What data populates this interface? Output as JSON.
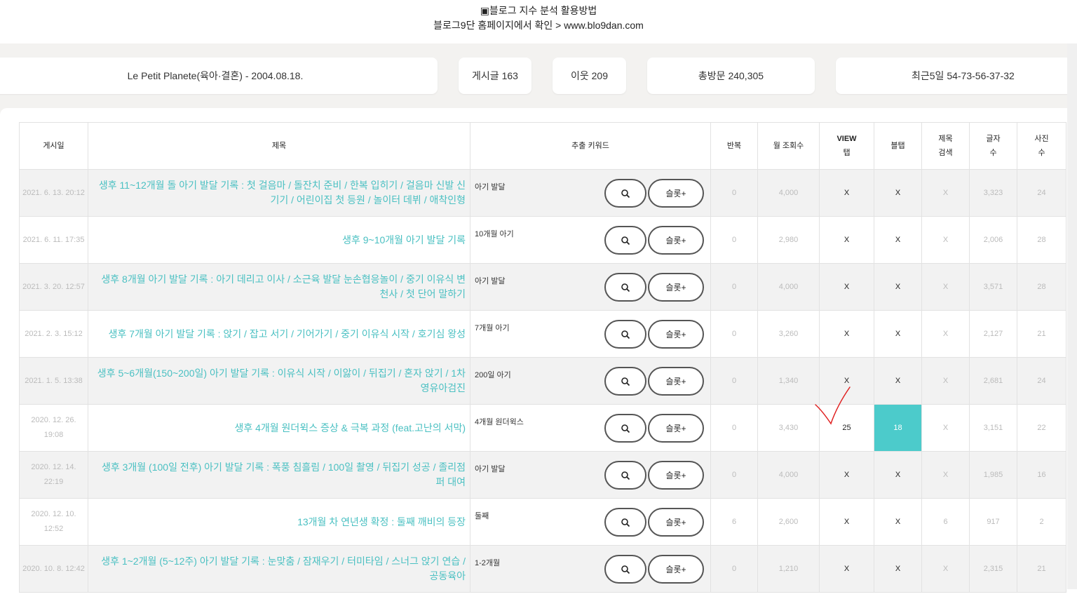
{
  "header": {
    "line1": "▣블로그 지수 분석 활용방법",
    "line2": "블로그9단 홈페이지에서 확인 > www.blo9dan.com"
  },
  "stats": {
    "blog": "Le Petit Planete(육아·결혼) - 2004.08.18.",
    "posts": "게시글 163",
    "neighbors": "이웃 209",
    "total_visits": "총방문 240,305",
    "recent": "최근5일 54-73-56-37-32"
  },
  "table": {
    "headers": {
      "date": "게시일",
      "title": "제목",
      "keyword": "추출 키워드",
      "repeat": "반복",
      "monthly": "월 조회수",
      "view1": "VIEW",
      "view2": "탭",
      "blog_tab": "블탭",
      "tsearch1": "제목",
      "tsearch2": "검색",
      "chars1": "글자",
      "chars2": "수",
      "photos1": "사진",
      "photos2": "수"
    },
    "slot_label": "슬롯+",
    "rows": [
      {
        "date": "2021. 6. 13. 20:12",
        "title": "생후 11~12개월 돌 아기 발달 기록 : 첫 걸음마 / 돌잔치 준비 / 한복 입히기 / 걸음마 신발 신기기 / 어린이집 첫 등원 / 놀이터 데뷔 / 애착인형",
        "keyword": "아기 발달",
        "repeat": "0",
        "monthly": "4,000",
        "view": "X",
        "blog": "X",
        "tsearch": "X",
        "chars": "3,323",
        "photos": "24"
      },
      {
        "date": "2021. 6. 11. 17:35",
        "title": "생후 9~10개월 아기 발달 기록",
        "keyword": "10개월 아기",
        "repeat": "0",
        "monthly": "2,980",
        "view": "X",
        "blog": "X",
        "tsearch": "X",
        "chars": "2,006",
        "photos": "28"
      },
      {
        "date": "2021. 3. 20. 12:57",
        "title": "생후 8개월 아기 발달 기록 : 아기 데리고 이사 / 소근육 발달 눈손협응놀이 / 중기 이유식 변천사 / 첫 단어 말하기",
        "keyword": "아기 발달",
        "repeat": "0",
        "monthly": "4,000",
        "view": "X",
        "blog": "X",
        "tsearch": "X",
        "chars": "3,571",
        "photos": "28"
      },
      {
        "date": "2021. 2. 3. 15:12",
        "title": "생후 7개월 아기 발달 기록 : 앉기 / 잡고 서기 / 기어가기 / 중기 이유식 시작 / 호기심 왕성",
        "keyword": "7개월 아기",
        "repeat": "0",
        "monthly": "3,260",
        "view": "X",
        "blog": "X",
        "tsearch": "X",
        "chars": "2,127",
        "photos": "21"
      },
      {
        "date": "2021. 1. 5. 13:38",
        "title": "생후 5~6개월(150~200일) 아기 발달 기록 : 이유식 시작 / 이앓이 / 뒤집기 / 혼자 앉기 / 1차 영유아검진",
        "keyword": "200일 아기",
        "repeat": "0",
        "monthly": "1,340",
        "view": "X",
        "blog": "X",
        "tsearch": "X",
        "chars": "2,681",
        "photos": "24"
      },
      {
        "date": "2020. 12. 26. 19:08",
        "title": "생후 4개월 원더윅스 증상 & 극복 과정 (feat.고난의 서막)",
        "keyword": "4개월 원더윅스",
        "repeat": "0",
        "monthly": "3,430",
        "view": "25",
        "blog": "18",
        "tsearch": "X",
        "chars": "3,151",
        "photos": "22"
      },
      {
        "date": "2020. 12. 14. 22:19",
        "title": "생후 3개월 (100일 전후) 아기 발달 기록 : 폭풍 침흘림 / 100일 촬영 / 뒤집기 성공 / 졸리점퍼 대여",
        "keyword": "아기 발달",
        "repeat": "0",
        "monthly": "4,000",
        "view": "X",
        "blog": "X",
        "tsearch": "X",
        "chars": "1,985",
        "photos": "16"
      },
      {
        "date": "2020. 12. 10. 12:52",
        "title": "13개월 차 연년생 확정 : 둘째 깨비의 등장",
        "keyword": "둘째",
        "repeat": "6",
        "monthly": "2,600",
        "view": "X",
        "blog": "X",
        "tsearch": "6",
        "chars": "917",
        "photos": "2"
      },
      {
        "date": "2020. 10. 8. 12:42",
        "title": "생후 1~2개월 (5~12주) 아기 발달 기록 : 눈맞춤 / 잠재우기 / 터미타임 / 스너그 앉기 연습 / 공동육아",
        "keyword": "1-2개월",
        "repeat": "0",
        "monthly": "1,210",
        "view": "X",
        "blog": "X",
        "tsearch": "X",
        "chars": "2,315",
        "photos": "21"
      }
    ]
  },
  "colors": {
    "accent_teal": "#4ccbcb",
    "title_link": "#4ac0c2",
    "check_mark": "#e02020"
  }
}
